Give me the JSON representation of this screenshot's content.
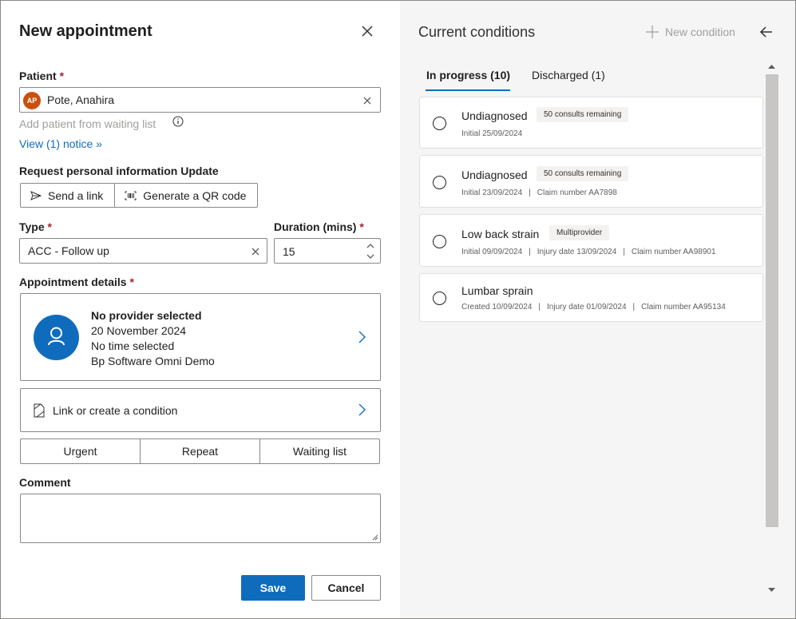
{
  "dialog": {
    "title": "New appointment",
    "patient_label": "Patient",
    "required_mark": "*",
    "patient": {
      "initials": "AP",
      "name": "Pote, Anahira",
      "avatar_color": "#ca5010"
    },
    "add_from_waiting_list": "Add patient from waiting list",
    "view_notice": "View (1) notice",
    "request_label": "Request personal information Update",
    "request_buttons": {
      "send_link": "Send a link",
      "qr_code": "Generate a QR code"
    },
    "type_label": "Type",
    "type_value": "ACC - Follow up",
    "duration_label": "Duration (mins)",
    "duration_value": "15",
    "appt_details_label": "Appointment details",
    "appointment": {
      "provider": "No provider selected",
      "date": "20 November 2024",
      "time": "No time selected",
      "location": "Bp Software Omni Demo"
    },
    "link_condition": "Link or create a condition",
    "priority_buttons": {
      "urgent": "Urgent",
      "repeat": "Repeat",
      "waiting_list": "Waiting list"
    },
    "comment_label": "Comment",
    "comment_value": "",
    "save": "Save",
    "cancel": "Cancel"
  },
  "conditions_panel": {
    "title": "Current conditions",
    "new_condition": "New condition",
    "tabs": [
      {
        "label": "In progress (10)",
        "active": true
      },
      {
        "label": "Discharged (1)",
        "active": false
      }
    ],
    "items": [
      {
        "name": "Undiagnosed",
        "badge": "50 consults remaining",
        "meta": [
          "Initial 25/09/2024"
        ]
      },
      {
        "name": "Undiagnosed",
        "badge": "50 consults remaining",
        "meta": [
          "Initial 23/09/2024",
          "Claim number AA7898"
        ]
      },
      {
        "name": "Low back strain",
        "badge": "Multiprovider",
        "meta": [
          "Initial 09/09/2024",
          "Injury date 13/09/2024",
          "Claim number AA98901"
        ]
      },
      {
        "name": "Lumbar sprain",
        "badge": "",
        "meta": [
          "Created 10/09/2024",
          "Injury date 01/09/2024",
          "Claim number AA95134"
        ]
      }
    ]
  },
  "colors": {
    "accent": "#0f6cbd",
    "required": "#a4262c",
    "panel_bg": "#f5f5f5"
  }
}
